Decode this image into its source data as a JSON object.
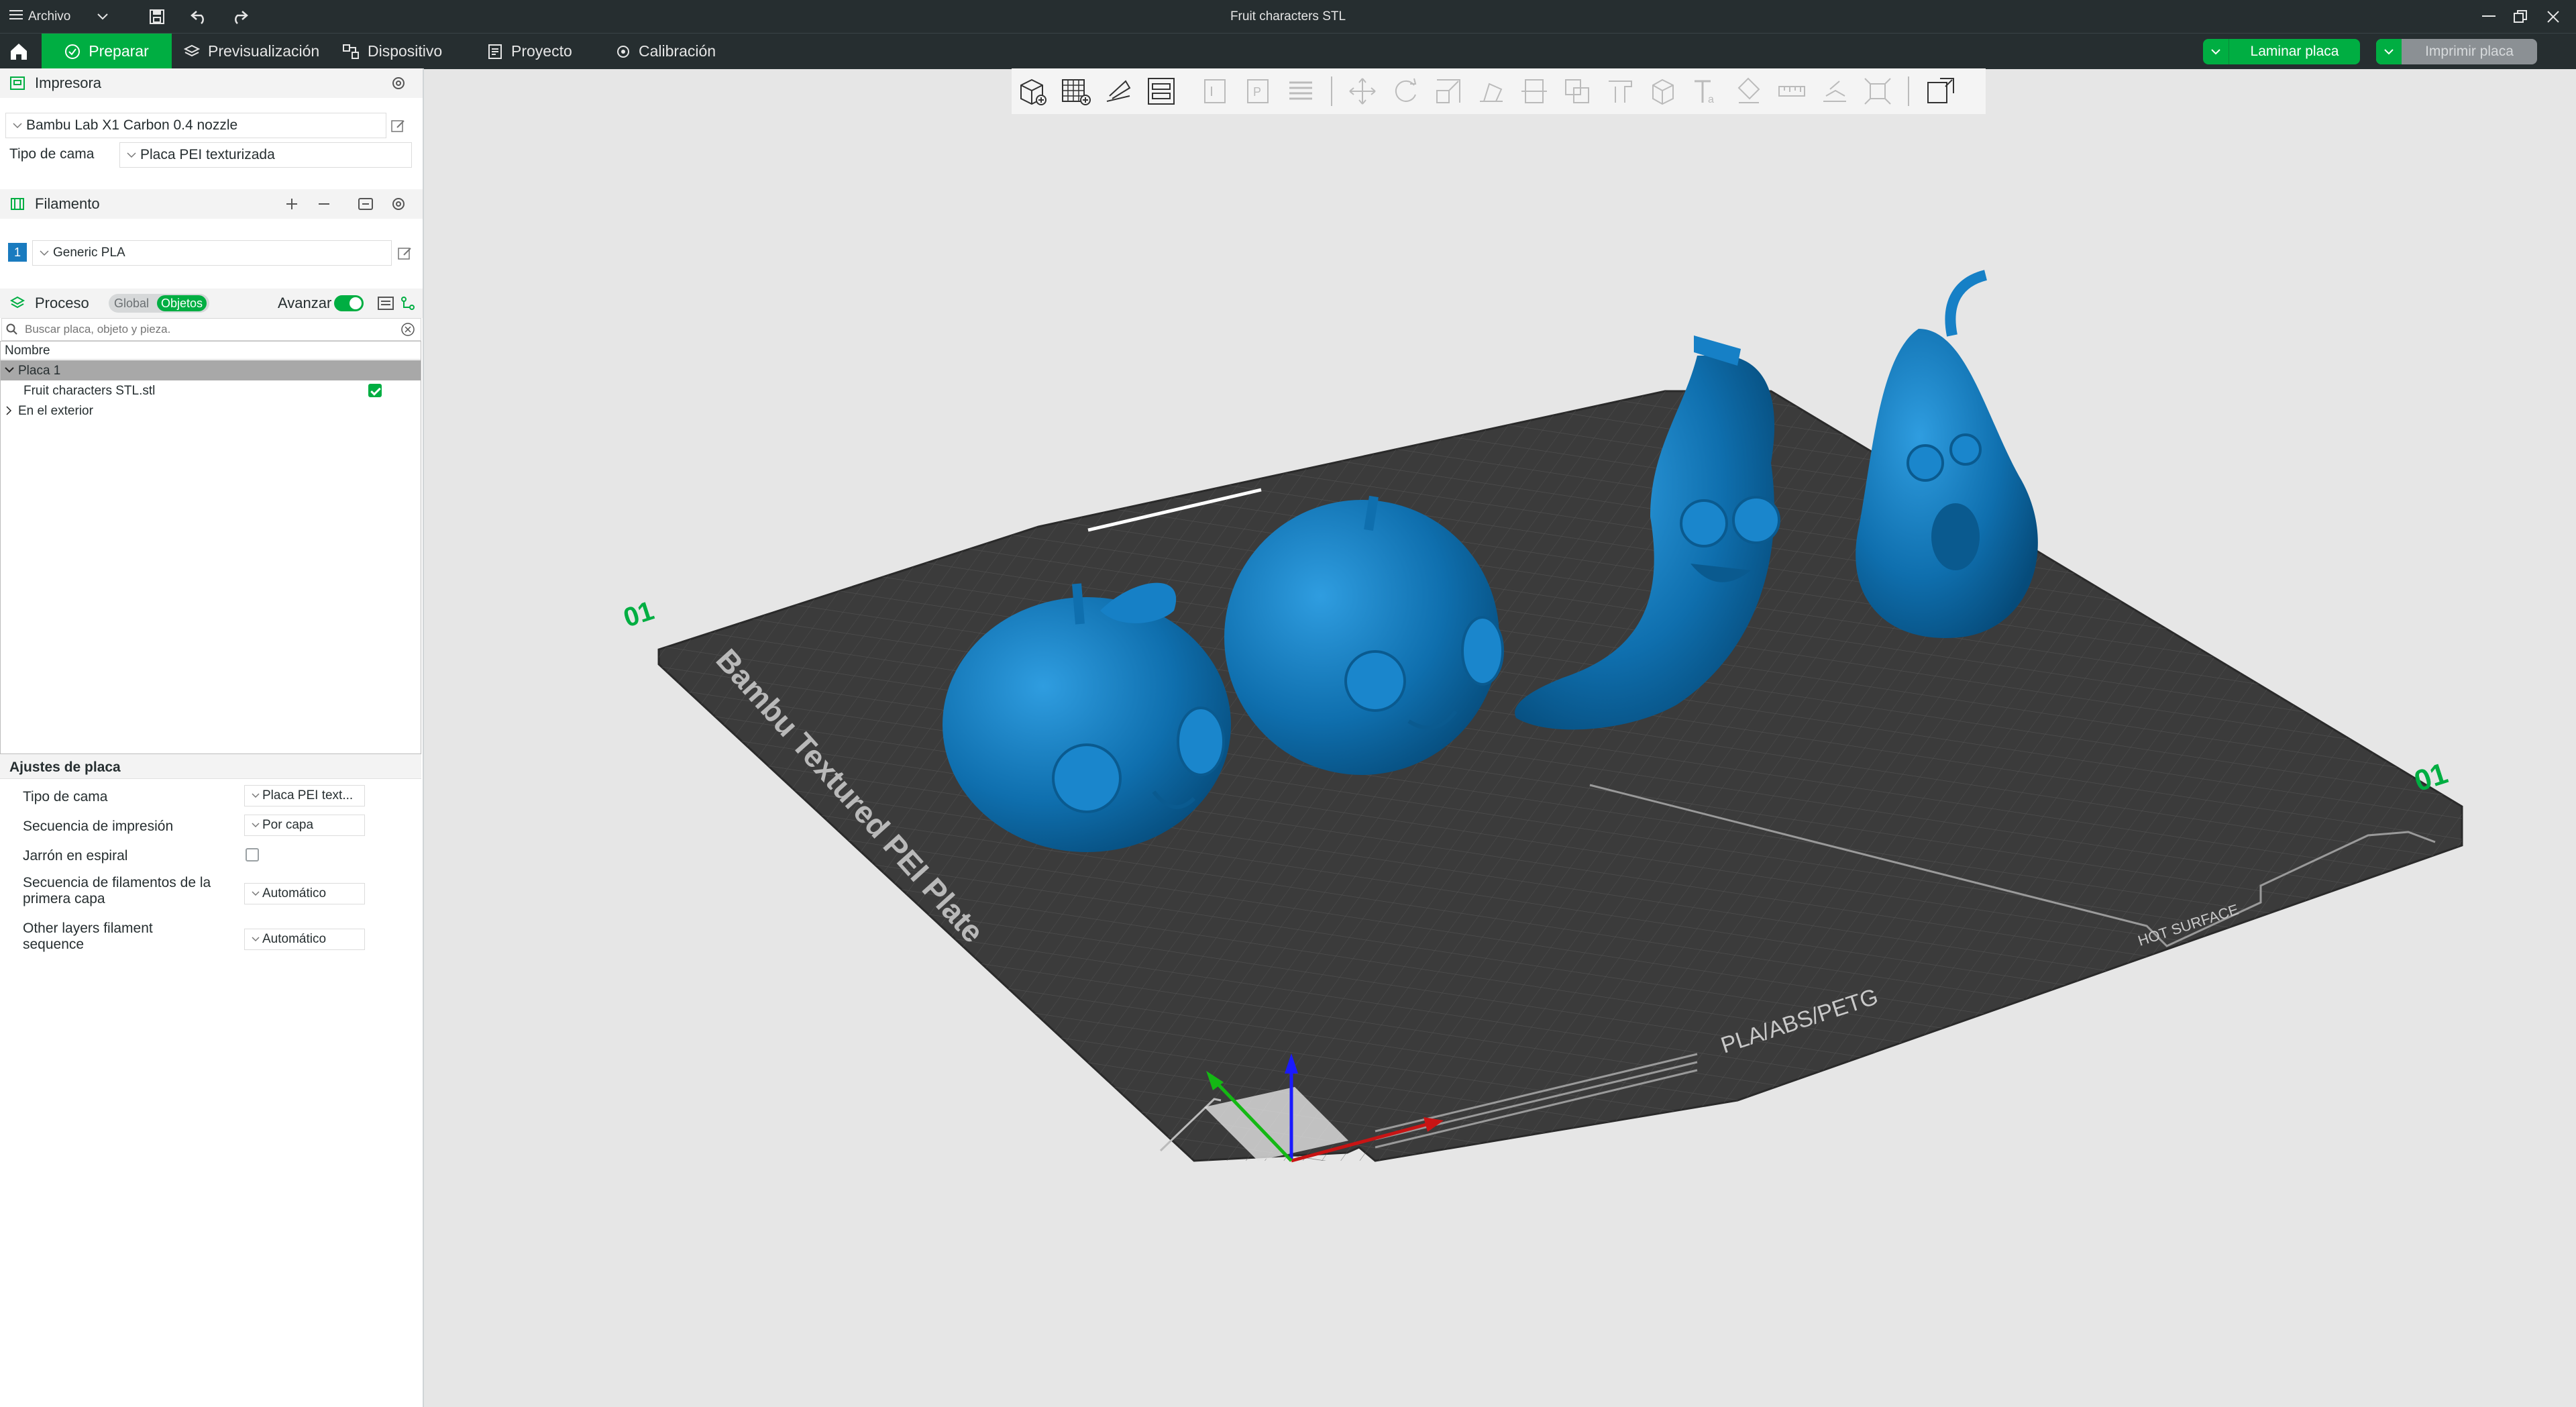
{
  "window": {
    "title": "Fruit characters STL",
    "file_menu": "Archivo"
  },
  "tabs": [
    {
      "id": "preparar",
      "label": "Preparar"
    },
    {
      "id": "previsualizacion",
      "label": "Previsualización"
    },
    {
      "id": "dispositivo",
      "label": "Dispositivo"
    },
    {
      "id": "proyecto",
      "label": "Proyecto"
    },
    {
      "id": "calibracion",
      "label": "Calibración"
    }
  ],
  "actions": {
    "slice": "Laminar placa",
    "print": "Imprimir placa"
  },
  "printer": {
    "header": "Impresora",
    "model": "Bambu Lab X1 Carbon 0.4 nozzle",
    "bed_label": "Tipo de cama",
    "bed_value": "Placa PEI texturizada"
  },
  "filament": {
    "header": "Filamento",
    "slot": "1",
    "name": "Generic PLA"
  },
  "process": {
    "header": "Proceso",
    "global": "Global",
    "objects": "Objetos",
    "advance": "Avanzar",
    "search_placeholder": "Buscar placa, objeto y pieza.",
    "column": "Nombre",
    "tree": {
      "plate": "Placa 1",
      "object": "Fruit characters STL.stl",
      "outside": "En el exterior"
    }
  },
  "plate_settings": {
    "header": "Ajustes de placa",
    "rows": [
      {
        "label": "Tipo de cama",
        "value": "Placa PEI text..."
      },
      {
        "label": "Secuencia de impresión",
        "value": "Por capa"
      },
      {
        "label": "Jarrón en espiral",
        "value": ""
      },
      {
        "label": "Secuencia de filamentos de la primera capa",
        "value": "Automático"
      },
      {
        "label": "Other layers filament sequence",
        "value": "Automático"
      }
    ]
  },
  "bed": {
    "brand_text": "Bambu Textured PEI Plate",
    "material_text": "PLA/ABS/PETG",
    "hot_surface": "HOT SURFACE",
    "plate_number": "01"
  },
  "colors": {
    "accent": "#00ae42",
    "dark": "#262e30",
    "model": "#1a7bbf",
    "bed": "#3a3a3a"
  }
}
